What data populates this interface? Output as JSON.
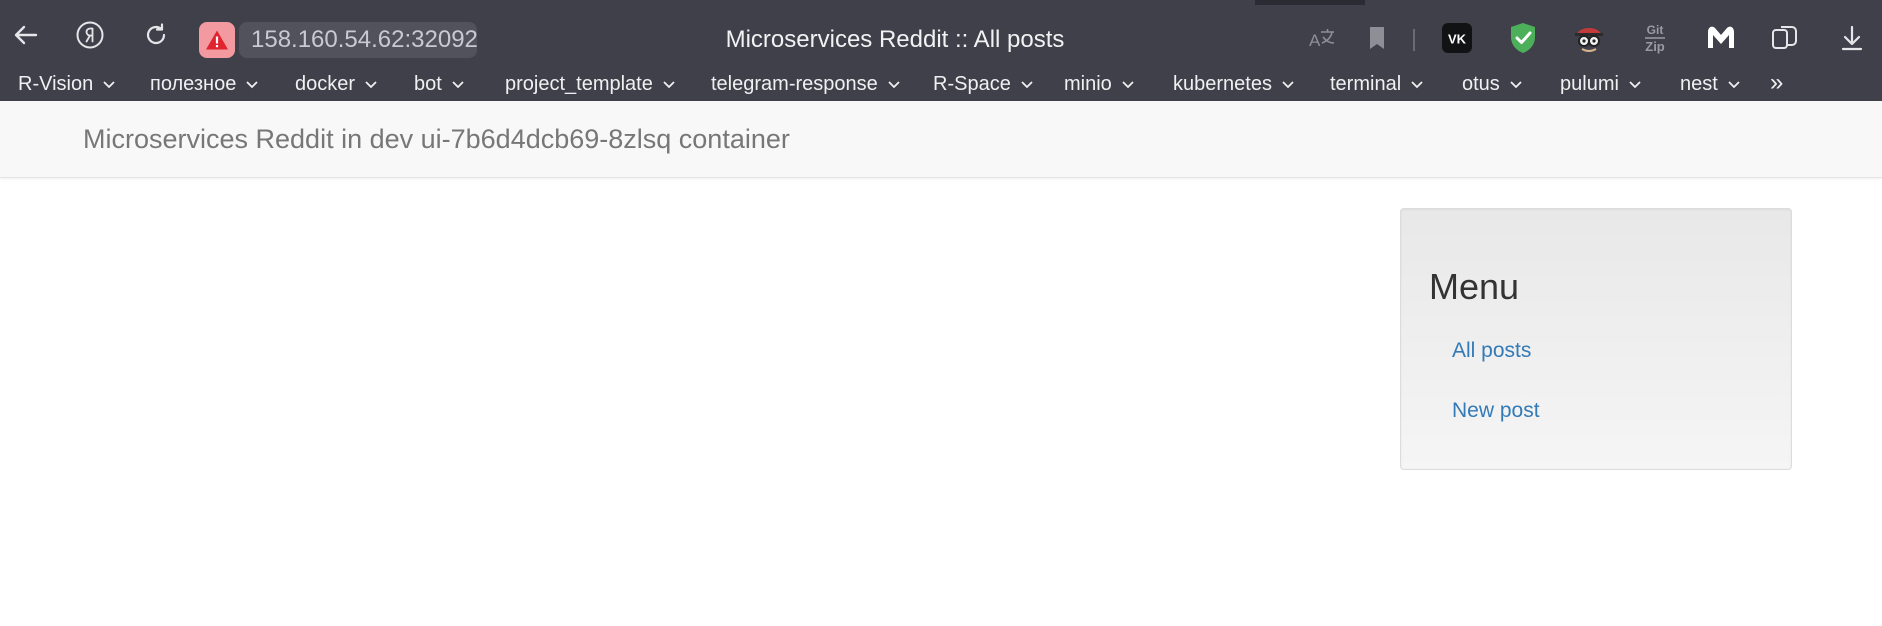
{
  "browser": {
    "address": "158.160.54.62:32092",
    "title": "Microservices Reddit :: All posts",
    "bookmarks": [
      "R-Vision",
      "полезное",
      "docker",
      "bot",
      "project_template",
      "telegram-response",
      "R-Space",
      "minio",
      "kubernetes",
      "terminal",
      "otus",
      "pulumi",
      "nest"
    ],
    "bookmarks_more": "»",
    "extensions": {
      "vk_label": "VK",
      "gitzip_top": "Git",
      "gitzip_bottom": "Zip"
    }
  },
  "navbar": {
    "brand": "Microservices Reddit in dev ui-7b6d4dcb69-8zlsq container"
  },
  "menu": {
    "title": "Menu",
    "links": [
      "All posts",
      "New post"
    ]
  },
  "colors": {
    "chrome_bg": "#3f4049",
    "link": "#337ab7",
    "brand_text": "#777777"
  }
}
